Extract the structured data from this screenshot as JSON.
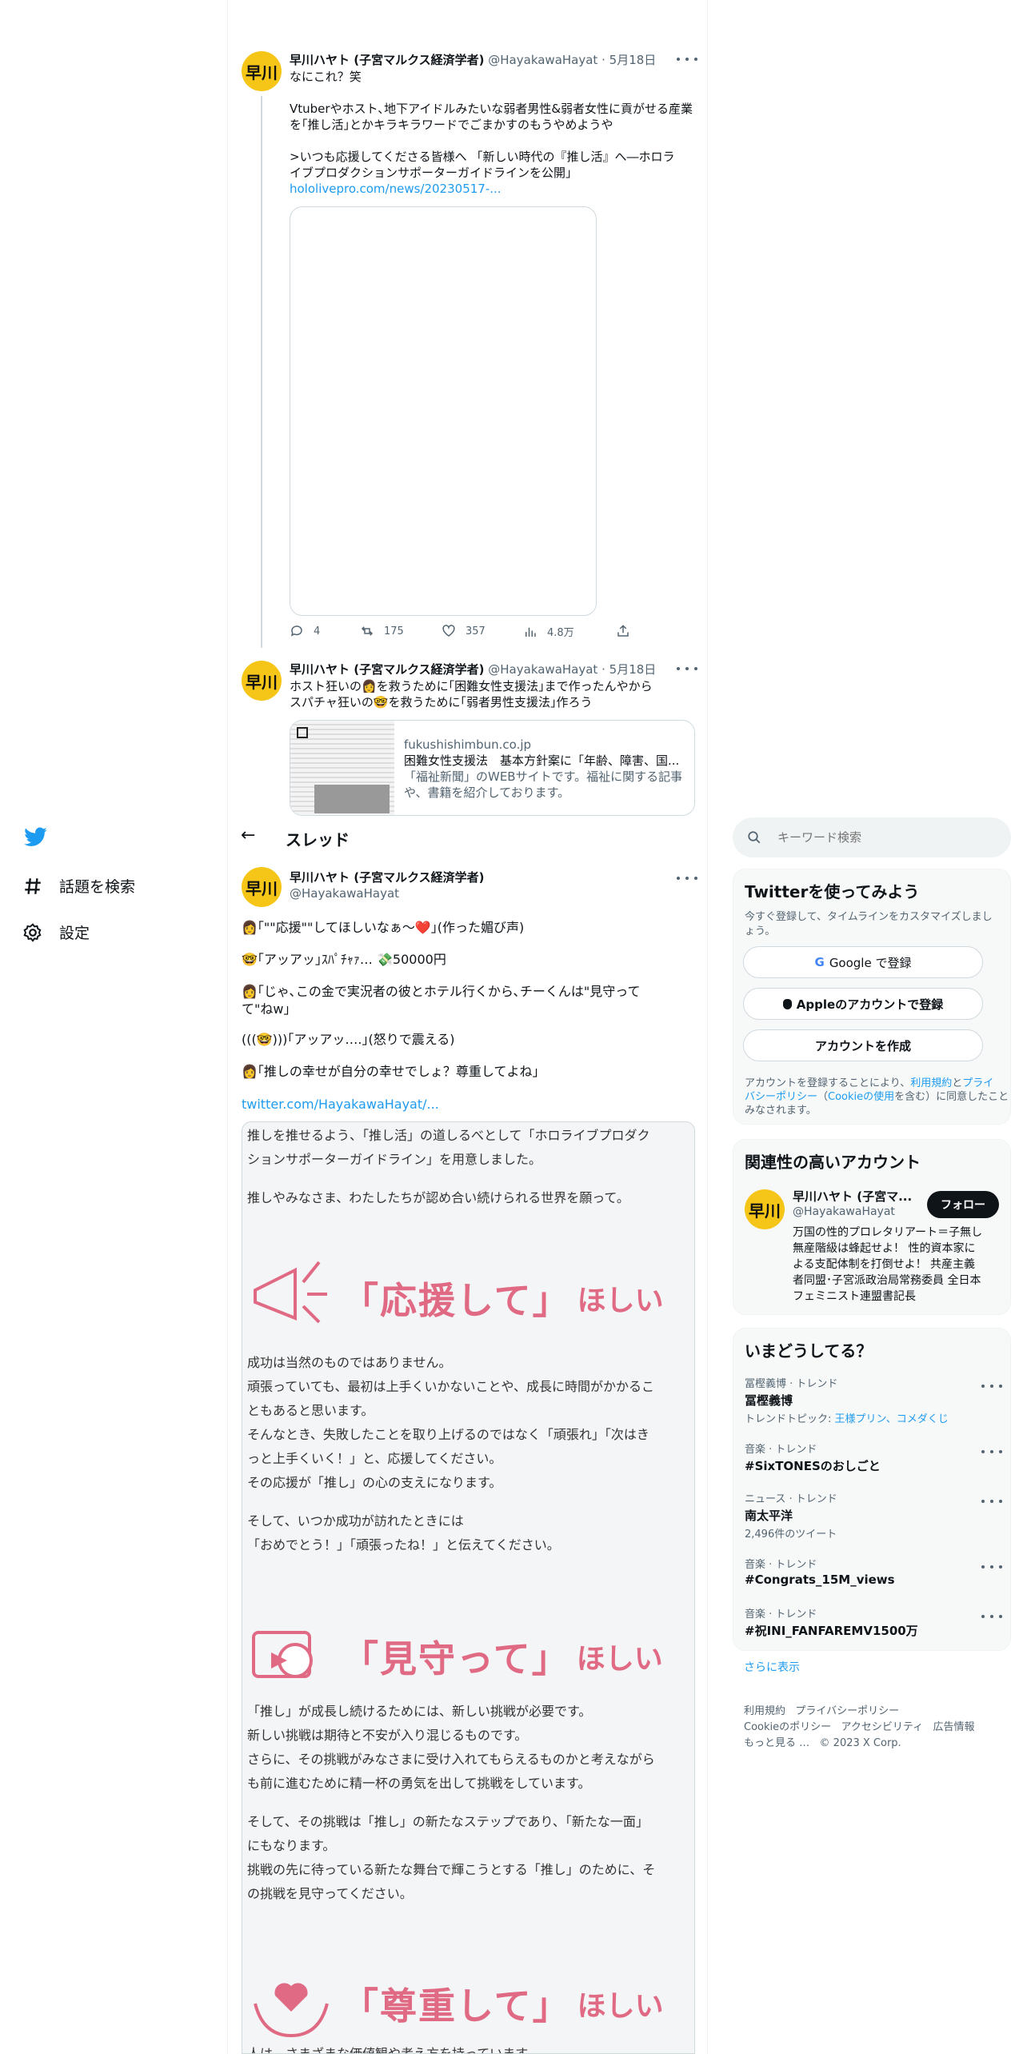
{
  "upper_tweet": {
    "avatar_text": "早川",
    "name": "早川ハヤト (子宮マルクス経済学者)",
    "handle": "@HayakawaHayat",
    "date": "· 5月18日",
    "lines": [
      "なにこれ？笑",
      "",
      "Vtuberやホスト､地下アイドルみたいな弱者男性&弱者女性に貢がせる産業",
      "を｢推し活｣とかキラキラワードでごまかすのもうやめようや",
      "",
      ">いつも応援してくださる皆様へ 「新しい時代の『推し活』へ―ホロラ",
      "イブプロダクションサポーターガイドラインを公開」"
    ],
    "link": "hololivepro.com/news/20230517-...",
    "replies": "4",
    "retweets": "175",
    "likes": "357",
    "views": "4.8万"
  },
  "second_tweet": {
    "avatar_text": "早川",
    "name": "早川ハヤト (子宮マルクス経済学者)",
    "handle": "@HayakawaHayat",
    "date": "· 5月18日",
    "lines": [
      "ホスト狂いの👩を救うために｢困難女性支援法｣まで作ったんやから",
      "スパチャ狂いの🤓を救うために｢弱者男性支援法｣作ろう"
    ],
    "card_domain": "fukushishimbun.co.jp",
    "card_title": "困難女性支援法　基本方針案に「年齢、障害、国...",
    "card_desc1": "「福祉新聞」のWEBサイトです。福祉に関する記事",
    "card_desc2": "や、書籍を紹介しております。"
  },
  "left_nav": {
    "items": [
      {
        "label": "話題を検索",
        "icon": "hashtag-icon"
      },
      {
        "label": "設定",
        "icon": "gear-icon"
      }
    ]
  },
  "header": {
    "title": "スレッド",
    "back": "←"
  },
  "main_tweet": {
    "avatar_text": "早川",
    "name": "早川ハヤト (子宮マルクス経済学者)",
    "handle": "@HayakawaHayat",
    "lines": [
      "👩｢\"\"応援\"\"してほしいなぁ～❤️｣(作った媚び声)",
      "🤓｢アッアッ｣ｽﾊﾟﾁｬｧ… 💸50000円",
      "👩｢じゃ､この金で実況者の彼とホテル行くから､チーくんは\"見守って",
      "て\"ねw｣",
      "(((🤓)))｢アッアッ….｣(怒りで震える)",
      "👩｢推しの幸せが自分の幸せでしょ？尊重してよね｣"
    ],
    "link": "twitter.com/HayakawaHayat/..."
  },
  "image_card": {
    "intro1": "推しを推せるよう、「推し活」の道しるべとして「ホロライブプロダク",
    "intro2": "ションサポーターガイドライン」を用意しました。",
    "intro3": "推しやみなさま、わたしたちが認め合い続けられる世界を願って。",
    "h1_big": "「応援して」",
    "h1_small": "ほしい",
    "p1": [
      "成功は当然のものではありません。",
      "頑張っていても、最初は上手くいかないことや、成長に時間がかかるこ",
      "ともあると思います。",
      "そんなとき、失敗したことを取り上げるのではなく「頑張れ」「次はき",
      "っと上手くいく！」と、応援してください。",
      "その応援が「推し」の心の支えになります。"
    ],
    "p1b": [
      "そして、いつか成功が訪れたときには",
      "「おめでとう！」「頑張ったね！」と伝えてください。"
    ],
    "h2_big": "「見守って」",
    "h2_small": "ほしい",
    "p2": [
      "「推し」が成長し続けるためには、新しい挑戦が必要です。",
      "新しい挑戦は期待と不安が入り混じるものです。",
      "さらに、その挑戦がみなさまに受け入れてもらえるものかと考えながら",
      "も前に進むために精一杯の勇気を出して挑戦をしています。"
    ],
    "p2b": [
      "そして、その挑戦は「推し」の新たなステップであり、「新たな一面」",
      "にもなります。",
      "挑戦の先に待っている新たな舞台で輝こうとする「推し」のために、そ",
      "の挑戦を見守ってください。"
    ],
    "h3_big": "「尊重して」",
    "h3_small": "ほしい",
    "p3": "人は、さまざまな価値観や考え方を持っています。"
  },
  "search": {
    "placeholder": "キーワード検索"
  },
  "signup_box": {
    "title": "Twitterを使ってみよう",
    "sub1": "今すぐ登録して、タイムラインをカスタマイズしまし",
    "sub2": "ょう。",
    "google": "Google で登録",
    "apple": "Appleのアカウントで登録",
    "create": "アカウントを作成",
    "terms1a": "アカウントを登録することにより、",
    "terms1b": "利用規約",
    "terms1c": "と",
    "terms1d": "プライ",
    "terms2a": "バシーポリシー",
    "terms2b": "（",
    "terms2c": "Cookieの使用",
    "terms2d": "を含む）に同意したこと",
    "terms3": "みなされます。"
  },
  "related": {
    "title": "関連性の高いアカウント",
    "avatar_text": "早川",
    "name": "早川ハヤト (子宮マ...",
    "handle": "@HayakawaHayat",
    "follow": "フォロー",
    "bio": [
      "万国の性的プロレタリアート＝子無し",
      "無産階級は蜂起せよ！ 性的資本家に",
      "よる支配体制を打倒せよ！ 共産主義",
      "者同盟･子宮派政治局常務委員 全日本",
      "フェミニスト連盟書記長"
    ]
  },
  "trends": {
    "title": "いまどうしてる？",
    "items": [
      {
        "meta": "冨樫義博 · トレンド",
        "title": "冨樫義博",
        "sub": "トレンドトピック: ",
        "sub_link": "王様プリン、コメダくじ"
      },
      {
        "meta": "音楽 · トレンド",
        "title": "#SixTONESのおしごと",
        "sub": "",
        "sub_link": ""
      },
      {
        "meta": "ニュース · トレンド",
        "title": "南太平洋",
        "sub": "2,496件のツイート",
        "sub_link": ""
      },
      {
        "meta": "音楽 · トレンド",
        "title": "#Congrats_15M_views",
        "sub": "",
        "sub_link": ""
      },
      {
        "meta": "音楽 · トレンド",
        "title": "#祝INI_FANFAREMV1500万",
        "sub": "",
        "sub_link": ""
      }
    ],
    "more": "さらに表示"
  },
  "footer": {
    "l1a": "利用規約",
    "l1b": "プライバシーポリシー",
    "l2a": "Cookieのポリシー",
    "l2b": "アクセシビリティ",
    "l2c": "広告情報",
    "l3a": "もっと見る …",
    "l3b": "© 2023 X Corp."
  },
  "colors": {
    "accent": "#1d9bf0",
    "avatar": "#f5c518",
    "heading_pink": "#e06a84"
  }
}
